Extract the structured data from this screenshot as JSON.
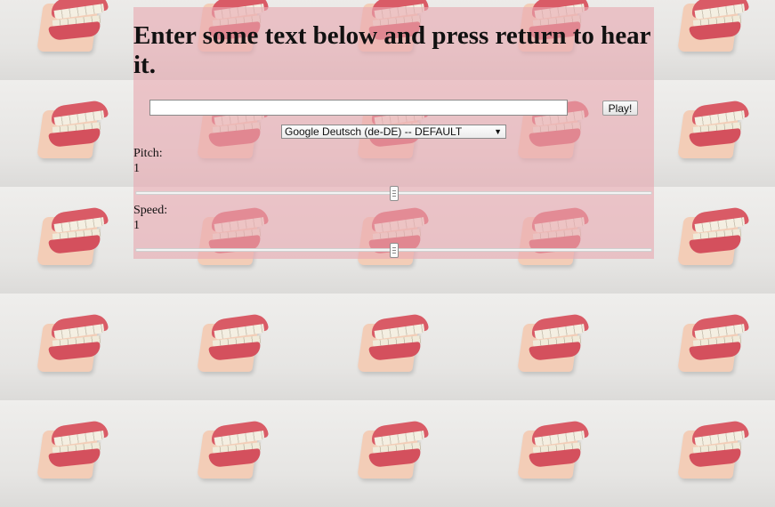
{
  "heading": "Enter some text below and press return to hear it.",
  "text_input": {
    "value": "",
    "placeholder": ""
  },
  "play_button": {
    "label": "Play!"
  },
  "voice_select": {
    "selected": "Google Deutsch (de-DE) -- DEFAULT"
  },
  "pitch": {
    "label": "Pitch:",
    "value": "1",
    "level": 0.5
  },
  "speed": {
    "label": "Speed:",
    "value": "1",
    "level": 0.5
  },
  "icons": {
    "select_arrow": "▼"
  },
  "colors": {
    "panel": "#e8aab2",
    "heading_text": "#111111"
  }
}
